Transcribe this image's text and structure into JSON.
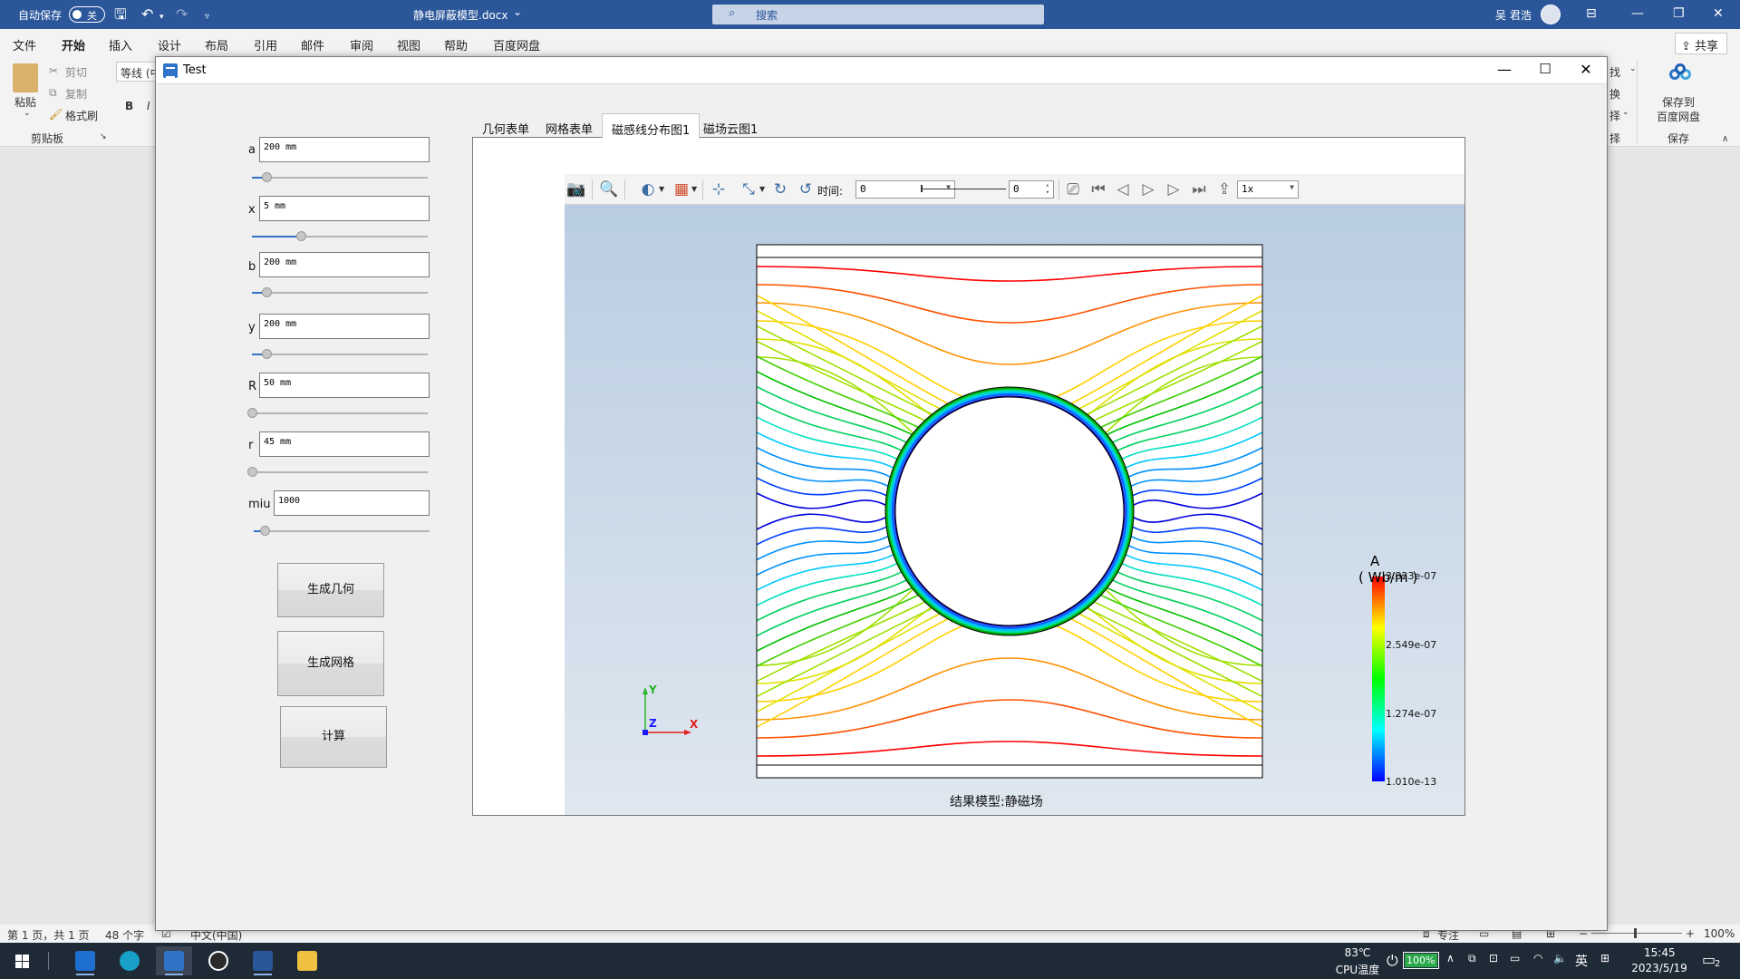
{
  "word": {
    "autosave_label": "自动保存",
    "autosave_state": "关",
    "doc_title": "静电屏蔽模型.docx",
    "title_caret": "⌄",
    "search_placeholder": "搜索",
    "user_name": "吴 君浩",
    "ribbon_tabs": [
      "文件",
      "开始",
      "插入",
      "设计",
      "布局",
      "引用",
      "邮件",
      "审阅",
      "视图",
      "帮助",
      "百度网盘"
    ],
    "share_label": "共享",
    "clipboard": {
      "paste": "粘贴",
      "cut": "剪切",
      "copy": "复制",
      "format_painter": "格式刷",
      "group": "剪贴板"
    },
    "font_name": "等线 (中",
    "bold": "B",
    "italic": "I",
    "edit_right": [
      "找",
      "换",
      "择"
    ],
    "save_baidu": {
      "line1": "保存到",
      "line2": "百度网盘",
      "group": "保存"
    },
    "status": {
      "page": "第 1 页，共 1 页",
      "words": "48 个字",
      "lang": "中文(中国)",
      "focus": "专注",
      "zoom": "100%"
    }
  },
  "test_window": {
    "title": "Test",
    "params": [
      {
        "label": "a",
        "value": "200 mm",
        "slider": 0.08
      },
      {
        "label": "x",
        "value": "5 mm",
        "slider": 0.28
      },
      {
        "label": "b",
        "value": "200 mm",
        "slider": 0.08
      },
      {
        "label": "y",
        "value": "200 mm",
        "slider": 0.08
      },
      {
        "label": "R",
        "value": "50 mm",
        "slider": 0.0
      },
      {
        "label": "r",
        "value": "45 mm",
        "slider": 0.0
      },
      {
        "label": "miu",
        "value": "1000",
        "slider": 0.06
      }
    ],
    "buttons": {
      "geometry": "生成几何",
      "mesh": "生成网格",
      "compute": "计算"
    },
    "tabs": [
      "几何表单",
      "网格表单",
      "磁感线分布图1",
      "磁场云图1"
    ],
    "active_tab": 2,
    "toolbar": {
      "time_label": "时间:",
      "time_value": "0",
      "step_value": "0",
      "speed_value": "1x"
    },
    "plot": {
      "caption": "结果模型:静磁场",
      "legend_title": "A",
      "legend_unit": "( Wb/m )",
      "legend_ticks": [
        "3.823e-07",
        "2.549e-07",
        "1.274e-07",
        "1.010e-13"
      ],
      "axis_labels": {
        "y": "Y",
        "z": "Z",
        "x": "X"
      }
    }
  },
  "taskbar": {
    "temp": "83℃",
    "temp_label": "CPU温度",
    "battery": "100%",
    "ime": "英",
    "time": "15:45",
    "date": "2023/5/19",
    "notif_count": "2"
  }
}
